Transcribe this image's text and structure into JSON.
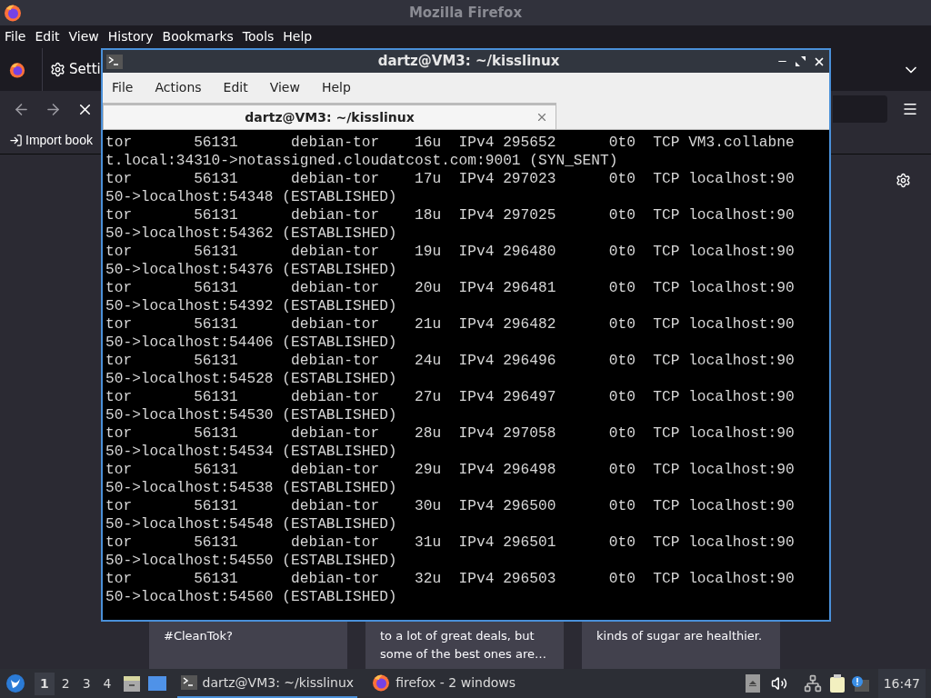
{
  "firefox": {
    "title": "Mozilla Firefox",
    "menu": [
      "File",
      "Edit",
      "View",
      "History",
      "Bookmarks",
      "Tools",
      "Help"
    ],
    "tab": "Setti",
    "bookmark": "Import book",
    "cards": [
      {
        "lines": [
          "#CleanTok?"
        ]
      },
      {
        "lines": [
          "to a lot of great deals, but",
          "some of the best ones are…"
        ]
      },
      {
        "lines": [
          "kinds of sugar are healthier."
        ]
      }
    ]
  },
  "terminal": {
    "title": "dartz@VM3: ~/kisslinux",
    "menu": [
      "File",
      "Actions",
      "Edit",
      "View",
      "Help"
    ],
    "tabs": [
      {
        "label": "dartz@VM3: ~/kisslinux",
        "selected": true
      }
    ],
    "lines": [
      "tor       56131      debian-tor    16u  IPv4 295652      0t0  TCP VM3.collabne",
      "t.local:34310->notassigned.cloudatcost.com:9001 (SYN_SENT)",
      "tor       56131      debian-tor    17u  IPv4 297023      0t0  TCP localhost:90",
      "50->localhost:54348 (ESTABLISHED)",
      "tor       56131      debian-tor    18u  IPv4 297025      0t0  TCP localhost:90",
      "50->localhost:54362 (ESTABLISHED)",
      "tor       56131      debian-tor    19u  IPv4 296480      0t0  TCP localhost:90",
      "50->localhost:54376 (ESTABLISHED)",
      "tor       56131      debian-tor    20u  IPv4 296481      0t0  TCP localhost:90",
      "50->localhost:54392 (ESTABLISHED)",
      "tor       56131      debian-tor    21u  IPv4 296482      0t0  TCP localhost:90",
      "50->localhost:54406 (ESTABLISHED)",
      "tor       56131      debian-tor    24u  IPv4 296496      0t0  TCP localhost:90",
      "50->localhost:54528 (ESTABLISHED)",
      "tor       56131      debian-tor    27u  IPv4 296497      0t0  TCP localhost:90",
      "50->localhost:54530 (ESTABLISHED)",
      "tor       56131      debian-tor    28u  IPv4 297058      0t0  TCP localhost:90",
      "50->localhost:54534 (ESTABLISHED)",
      "tor       56131      debian-tor    29u  IPv4 296498      0t0  TCP localhost:90",
      "50->localhost:54538 (ESTABLISHED)",
      "tor       56131      debian-tor    30u  IPv4 296500      0t0  TCP localhost:90",
      "50->localhost:54548 (ESTABLISHED)",
      "tor       56131      debian-tor    31u  IPv4 296501      0t0  TCP localhost:90",
      "50->localhost:54550 (ESTABLISHED)",
      "tor       56131      debian-tor    32u  IPv4 296503      0t0  TCP localhost:90",
      "50->localhost:54560 (ESTABLISHED)"
    ]
  },
  "taskbar": {
    "workspaces": [
      {
        "label": "1",
        "selected": true
      },
      {
        "label": "2",
        "selected": false
      },
      {
        "label": "3",
        "selected": false
      },
      {
        "label": "4",
        "selected": false
      }
    ],
    "tasks": [
      {
        "kind": "terminal",
        "label": "dartz@VM3: ~/kisslinux",
        "selected": true
      },
      {
        "kind": "firefox",
        "label": "firefox - 2 windows",
        "selected": false
      }
    ],
    "clock": "16:47"
  }
}
